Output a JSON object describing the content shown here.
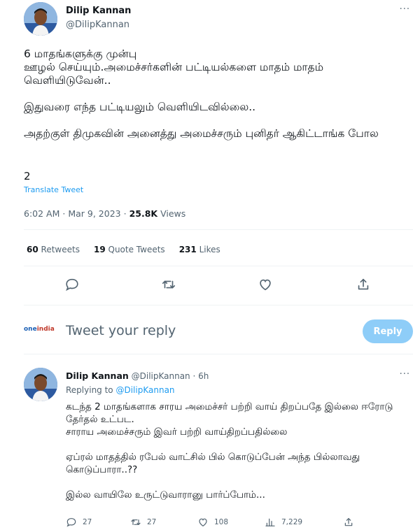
{
  "tweet": {
    "author_name": "Dilip Kannan",
    "author_handle": "@DilipKannan",
    "more_label": "···",
    "body_paragraphs": [
      "6 மாதங்களுக்கு முன்பு\nஊழல் செய்யும்.அமைச்சர்களின் பட்டியல்களை மாதம் மாதம் வெளியிடுவேன்..",
      "இதுவரை எந்த பட்டியலும் வெளியிடவில்லை..",
      "அதற்குள் திமுகவின் அனைத்து அமைச்சரும் புனிதர் ஆகிட்டாங்க போல"
    ],
    "count_line": "2",
    "translate_label": "Translate Tweet",
    "time": "6:02 AM",
    "date": "Mar 9, 2023",
    "views_count": "25.8K",
    "views_label": "Views",
    "separator": "·"
  },
  "stats": {
    "retweets_count": "60",
    "retweets_label": "Retweets",
    "quotes_count": "19",
    "quotes_label": "Quote Tweets",
    "likes_count": "231",
    "likes_label": "Likes"
  },
  "actions": {
    "icons": [
      "reply-icon",
      "retweet-icon",
      "like-icon",
      "share-icon"
    ],
    "color": "#536471"
  },
  "composer": {
    "logo_text_a": "one",
    "logo_text_b": "india",
    "placeholder": "Tweet your reply",
    "reply_button": "Reply",
    "button_color": "#8ecdf8"
  },
  "reply": {
    "author_name": "Dilip Kannan",
    "author_handle": "@DilipKannan",
    "time_ago": "6h",
    "separator": "·",
    "more_label": "···",
    "replying_to_prefix": "Replying to",
    "replying_to_handle": "@DilipKannan",
    "body_paragraphs": [
      "கடந்த 2 மாதங்களாக சாரய அமைச்சர் பற்றி வாய் திறப்பதே இல்லை ஈரோடு தேர்தல் உட்பட.\nசாராய அமைச்சரும் இவர் பற்றி வாய்திறப்பதில்லை",
      "ஏப்ரல் மாதத்தில் ரபேல் வாட்சில் பில் கொடுப்பேன் அந்த பில்லாவது கொடுப்பாரா..??",
      "இல்ல வாயிலே உருட்டுவாரானு பார்ப்போம்..."
    ],
    "replies": "27",
    "retweets": "27",
    "likes": "108",
    "views": "7,229"
  },
  "colors": {
    "link": "#1d9bf0",
    "secondary_text": "#536471",
    "primary_text": "#0f1419",
    "divider": "#eff3f4"
  }
}
